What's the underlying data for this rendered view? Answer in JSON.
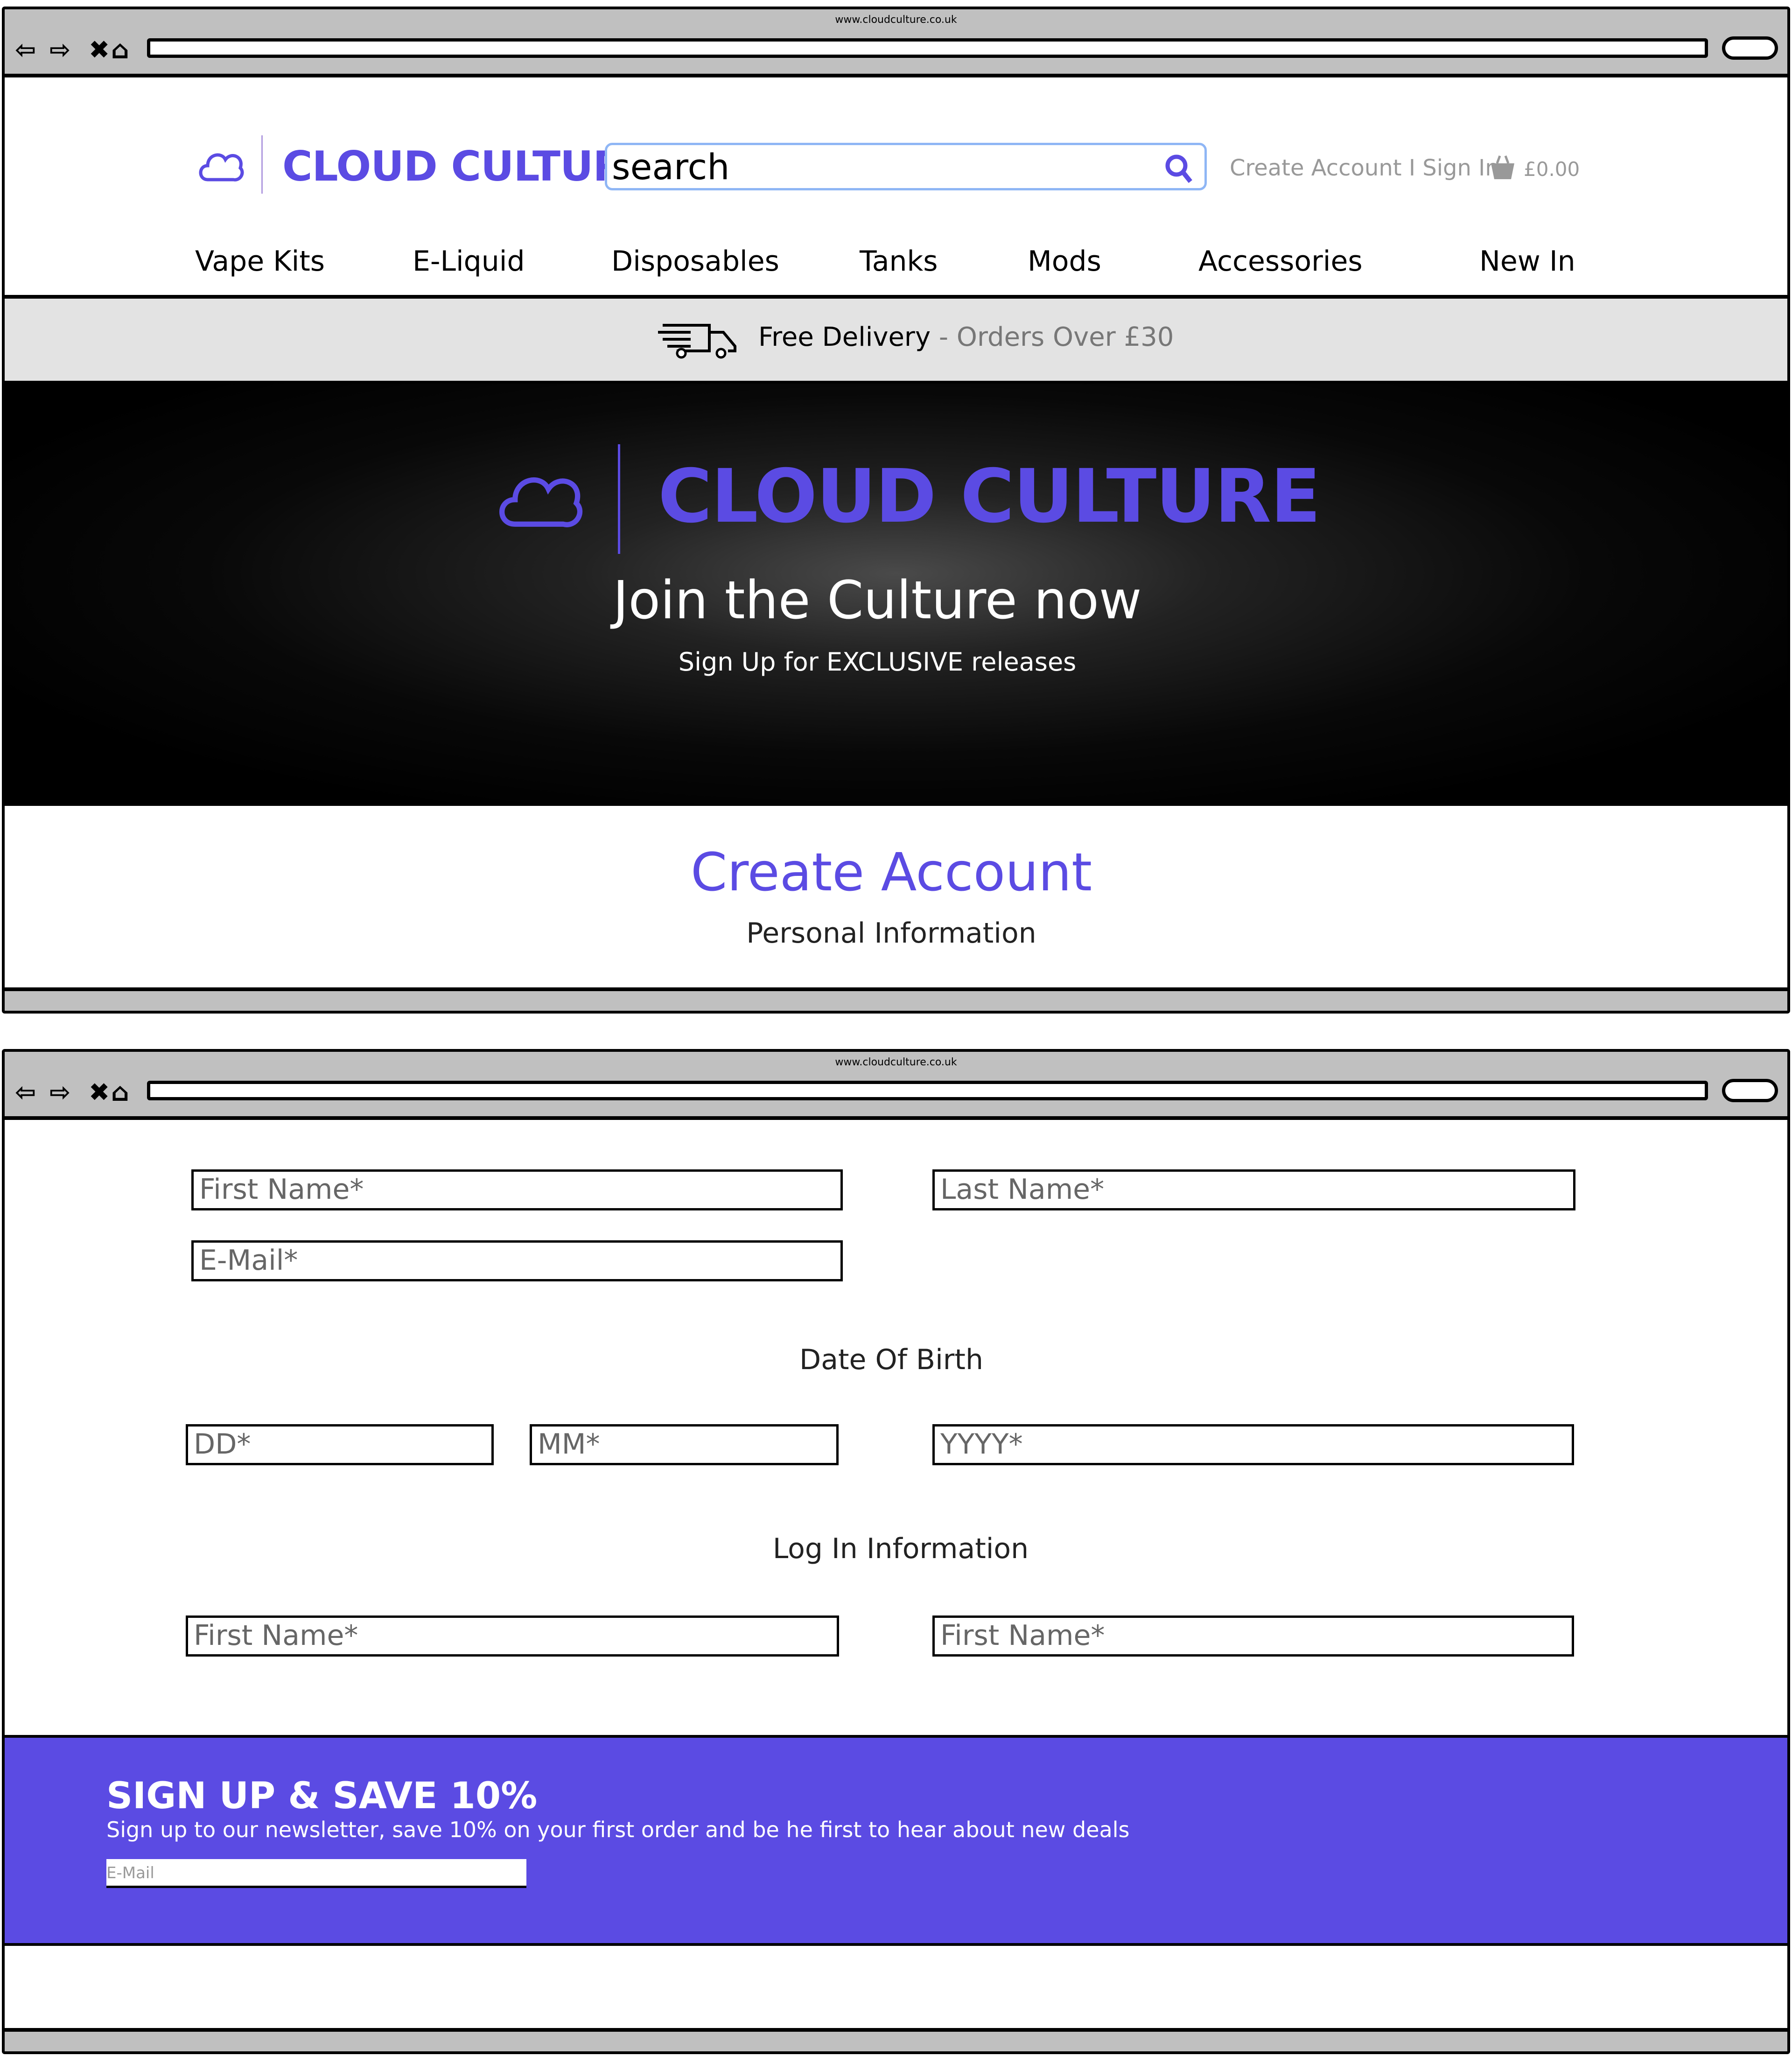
{
  "browser": {
    "url": "www.cloudculture.co.uk"
  },
  "header": {
    "brand": "CLOUD CULTURE",
    "search_placeholder": "search",
    "account_links": "Create Account I Sign In",
    "cart_total": "£0.00",
    "nav": [
      "Vape Kits",
      "E-Liquid",
      "Disposables",
      "Tanks",
      "Mods",
      "Accessories",
      "New In"
    ]
  },
  "delivery": {
    "bold": "Free Delivery",
    "rest": " - Orders Over £30"
  },
  "hero": {
    "brand": "CLOUD CULTURE",
    "title": "Join the Culture now",
    "subtitle": "Sign Up for EXCLUSIVE releases"
  },
  "page": {
    "title": "Create Account",
    "section_personal": "Personal Information",
    "section_dob": "Date Of Birth",
    "section_login": "Log In Information"
  },
  "form": {
    "first_name": "First Name*",
    "last_name": "Last Name*",
    "email": "E-Mail*",
    "dd": "DD*",
    "mm": "MM*",
    "yyyy": "YYYY*",
    "login_1": "First Name*",
    "login_2": "First Name*"
  },
  "newsletter": {
    "title": "SIGN UP & SAVE 10%",
    "text": "Sign up to our newsletter, save 10% on your first order and be he first to hear about new deals",
    "email_placeholder": "E-Mail"
  },
  "colors": {
    "accent": "#5b4be3",
    "toolbar": "#c0c0c0",
    "delivery_bg": "#e3e3e3"
  }
}
